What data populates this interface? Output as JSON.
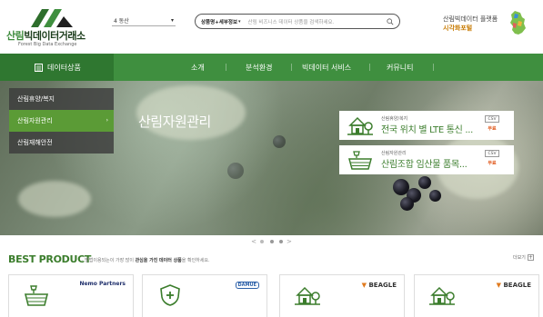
{
  "header": {
    "logo_main": "빅데이터거래소",
    "logo_accent": "산림",
    "logo_sub": "Forest Big Data Exchange",
    "region_select": "4 동산",
    "search": {
      "scope": "상품명+세부정보",
      "placeholder": "산림 비즈니스 데이터 상품을 검색하세요."
    },
    "platform_line1": "산림빅데이터 플랫폼",
    "platform_line2": "시각화포털"
  },
  "nav": {
    "data_products": "데이터상품",
    "items": [
      "소개",
      "분석환경",
      "빅데이터 서비스",
      "커뮤니티"
    ]
  },
  "hero": {
    "title": "산림자원관리",
    "side_menu": [
      {
        "label": "산림휴양/복지",
        "active": false
      },
      {
        "label": "산림자원관리",
        "active": true
      },
      {
        "label": "산림재해안전",
        "active": false
      }
    ],
    "promo_cards": [
      {
        "category": "산림휴양/복지",
        "title": "전국 위치 별 LTE 통신 ...",
        "chip": "CSV",
        "price": "무료"
      },
      {
        "category": "산림자원관리",
        "title": "산림조합 임산물 품목...",
        "chip": "CSV",
        "price": "무료"
      }
    ],
    "pager": {
      "prev": "<",
      "next": ">"
    }
  },
  "best_product": {
    "title": "BEST PRODUCT",
    "desc_prefix": "· 방법이용되는이 가장 많이 ",
    "desc_bold": "관심을 가진 데이터 상품",
    "desc_suffix": "을 확인하세요.",
    "more": "더보기",
    "more_icon": "+",
    "cards": [
      {
        "icon": "tree-basket-icon",
        "brand": "Nemo Partners"
      },
      {
        "icon": "shield-plus-icon",
        "brand": "DAMUE"
      },
      {
        "icon": "house-tree-icon",
        "brand": "BEAGLE"
      },
      {
        "icon": "house-tree-icon",
        "brand": "BEAGLE"
      }
    ]
  },
  "colors": {
    "brand_green": "#3f8f3f",
    "dark_green": "#2f7730",
    "accent_orange": "#e05a1e"
  }
}
